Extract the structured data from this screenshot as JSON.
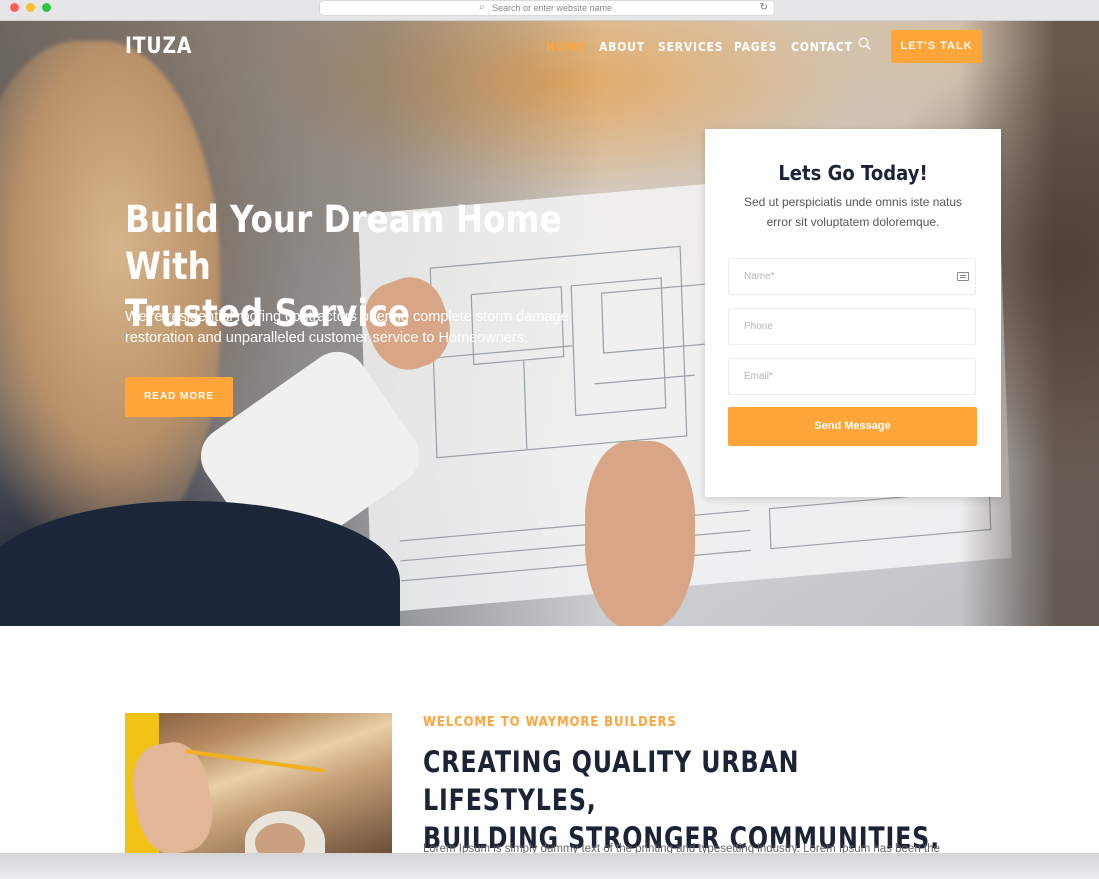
{
  "browser": {
    "url_placeholder": "Search or enter website name"
  },
  "brand": {
    "logo": "ITUZA",
    "accent_color": "#ffa53a",
    "dark_color": "#1c2337"
  },
  "nav": {
    "items": [
      {
        "label": "HOME",
        "active": true
      },
      {
        "label": "ABOUT",
        "active": false
      },
      {
        "label": "SERVICES",
        "active": false
      },
      {
        "label": "PAGES",
        "active": false
      },
      {
        "label": "CONTACT",
        "active": false
      }
    ],
    "cta": "LET'S TALK"
  },
  "hero": {
    "title_line1": "Build Your Dream Home With",
    "title_line2": "Trusted Service",
    "lead_line1": "We’re residential roofing contractors offering complete storm damage",
    "lead_line2": "restoration and unparalleled customer service to Homeowners.",
    "button": "READ MORE"
  },
  "form": {
    "title": "Lets Go Today!",
    "subtitle_line1": "Sed ut perspiciatis unde omnis iste natus",
    "subtitle_line2": "error sit voluptatem doloremque.",
    "name_placeholder": "Name*",
    "phone_placeholder": "Phone",
    "email_placeholder": "Email*",
    "submit": "Send Message"
  },
  "about": {
    "eyebrow": "WELCOME TO WAYMORE BUILDERS",
    "heading_line1": "CREATING QUALITY URBAN LIFESTYLES,",
    "heading_line2": "BUILDING STRONGER COMMUNITIES.",
    "paragraph": "Lorem Ipsum is simply dummy text of the printing and typesetting industry. Lorem Ipsum has been the"
  }
}
